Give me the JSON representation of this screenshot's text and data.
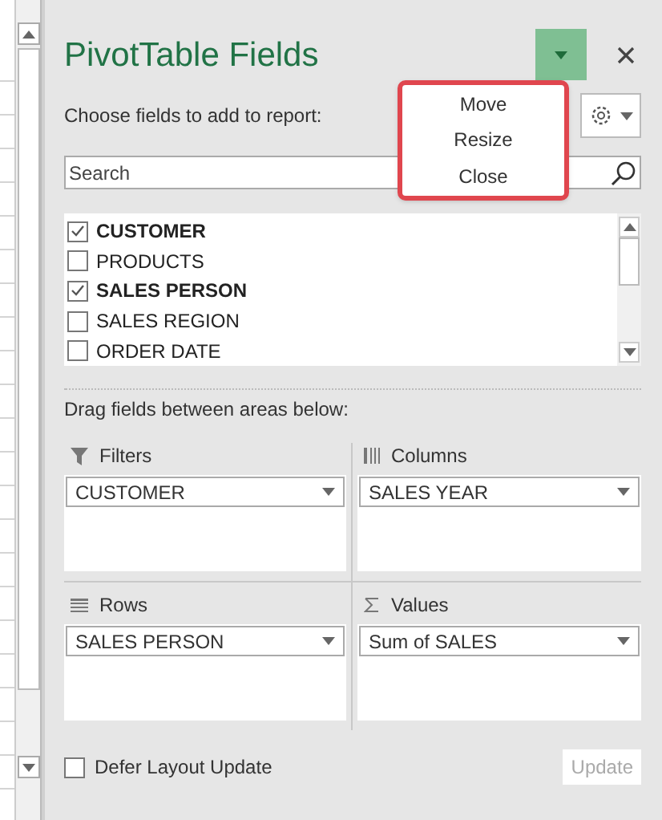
{
  "panel": {
    "title": "PivotTable Fields",
    "subtitle": "Choose fields to add to report:"
  },
  "menu": {
    "items": [
      {
        "label": "Move"
      },
      {
        "label": "Resize"
      },
      {
        "label": "Close"
      }
    ]
  },
  "search": {
    "placeholder": "Search"
  },
  "fields": [
    {
      "name": "CUSTOMER",
      "checked": true
    },
    {
      "name": "PRODUCTS",
      "checked": false
    },
    {
      "name": "SALES PERSON",
      "checked": true
    },
    {
      "name": "SALES REGION",
      "checked": false
    },
    {
      "name": "ORDER DATE",
      "checked": false
    }
  ],
  "areas_hint": "Drag fields between areas below:",
  "areas": [
    {
      "kind": "filters",
      "title": "Filters",
      "items": [
        "CUSTOMER"
      ]
    },
    {
      "kind": "columns",
      "title": "Columns",
      "items": [
        "SALES YEAR"
      ]
    },
    {
      "kind": "rows",
      "title": "Rows",
      "items": [
        "SALES PERSON"
      ]
    },
    {
      "kind": "values",
      "title": "Values",
      "items": [
        "Sum of SALES"
      ]
    }
  ],
  "defer": {
    "label": "Defer Layout Update",
    "checked": false
  },
  "update_button": {
    "label": "Update",
    "disabled": true
  }
}
